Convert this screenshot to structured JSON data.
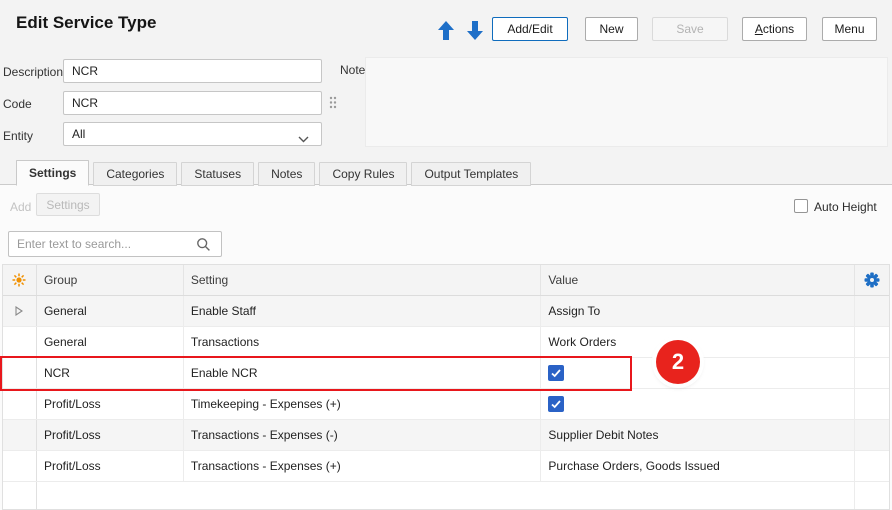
{
  "header": {
    "title": "Edit Service Type",
    "add_edit_button": "Add/Edit",
    "new_button": "New",
    "save_button": "Save",
    "actions_accel": "A",
    "actions_rest": "ctions",
    "menu_button": "Menu"
  },
  "form": {
    "description_label": "Description",
    "description_value": "NCR",
    "code_label": "Code",
    "code_value": "NCR",
    "entity_label": "Entity",
    "entity_value": "All",
    "note_label": "Note",
    "note_value": ""
  },
  "tabs": {
    "settings": "Settings",
    "categories": "Categories",
    "statuses": "Statuses",
    "notes": "Notes",
    "copy_rules": "Copy Rules",
    "output_templates": "Output Templates"
  },
  "toolbar": {
    "add_label": "Add",
    "settings_button": "Settings",
    "auto_height_label": "Auto Height"
  },
  "search": {
    "placeholder": "Enter text to search..."
  },
  "grid": {
    "columns": {
      "group": "Group",
      "setting": "Setting",
      "value": "Value"
    },
    "rows": [
      {
        "group": "General",
        "setting": "Enable Staff",
        "value": "Assign To"
      },
      {
        "group": "General",
        "setting": "Transactions",
        "value": "Work Orders"
      },
      {
        "group": "NCR",
        "setting": "Enable NCR",
        "value": "",
        "checked": true
      },
      {
        "group": "Profit/Loss",
        "setting": "Timekeeping - Expenses (+)",
        "value": "",
        "checked": true
      },
      {
        "group": "Profit/Loss",
        "setting": "Transactions - Expenses (-)",
        "value": "Supplier Debit Notes"
      },
      {
        "group": "Profit/Loss",
        "setting": "Transactions - Expenses (+)",
        "value": "Purchase Orders, Goods Issued"
      }
    ]
  },
  "annotation": {
    "badge_text": "2"
  },
  "colors": {
    "accent_blue": "#1f6fc5",
    "checkbox_blue": "#2a62c6",
    "annotation_red": "#e8231d",
    "header_icon_orange": "#f09000"
  }
}
